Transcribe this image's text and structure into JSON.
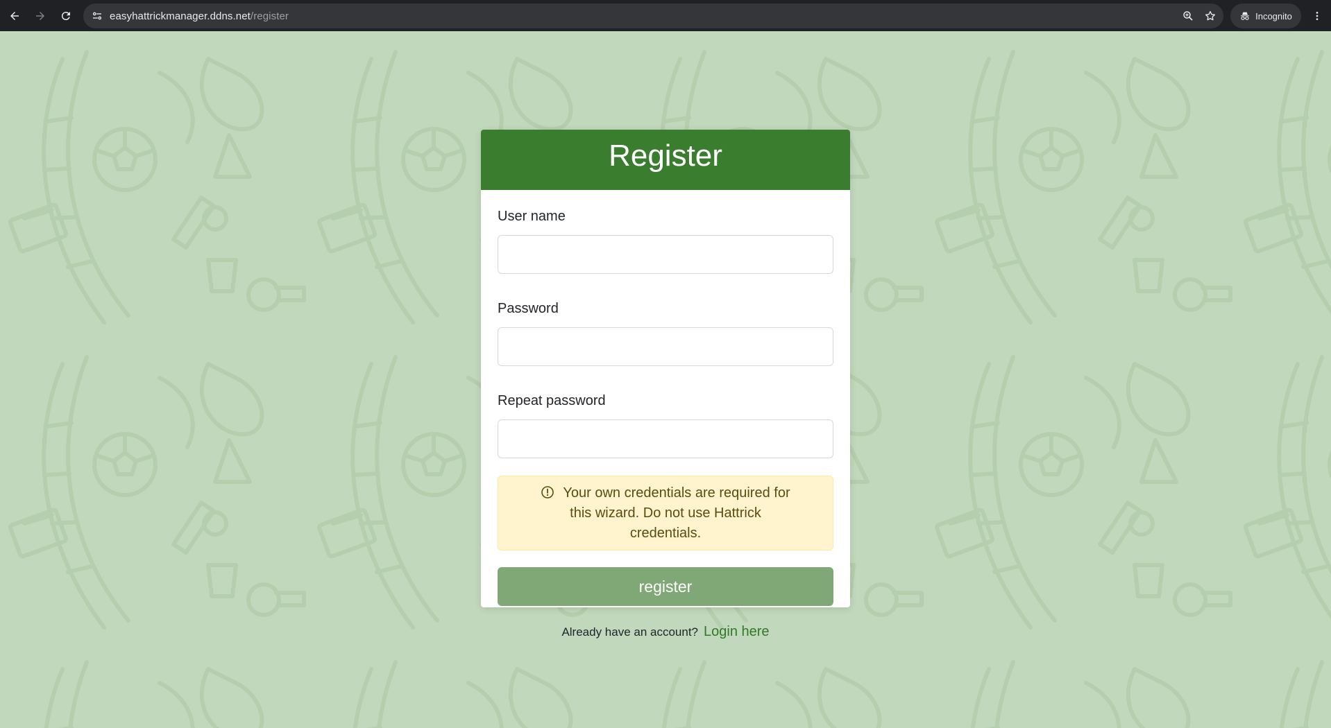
{
  "browser": {
    "url_host": "easyhattrickmanager.ddns.net",
    "url_path": "/register",
    "incognito_label": "Incognito",
    "icons": [
      "back-arrow-icon",
      "forward-arrow-icon",
      "reload-icon",
      "site-info-icon",
      "zoom-icon",
      "bookmark-star-icon",
      "incognito-icon",
      "kebab-menu-icon"
    ]
  },
  "form": {
    "title": "Register",
    "username_label": "User name",
    "username_value": "",
    "password_label": "Password",
    "password_value": "",
    "repeat_password_label": "Repeat password",
    "repeat_password_value": "",
    "alert_text": "Your own credentials are required for this wizard. Do not use Hattrick credentials.",
    "alert_icon": "exclamation-circle-icon",
    "submit_label": "register"
  },
  "footer": {
    "prompt": "Already have an account?",
    "login_link": "Login here"
  },
  "colors": {
    "header_green": "#3b7d2f",
    "button_green": "#80a877",
    "background_green": "#c2d8bc",
    "alert_bg": "#fff4cd",
    "alert_text": "#5c4b10",
    "link_green": "#2f7a25"
  }
}
